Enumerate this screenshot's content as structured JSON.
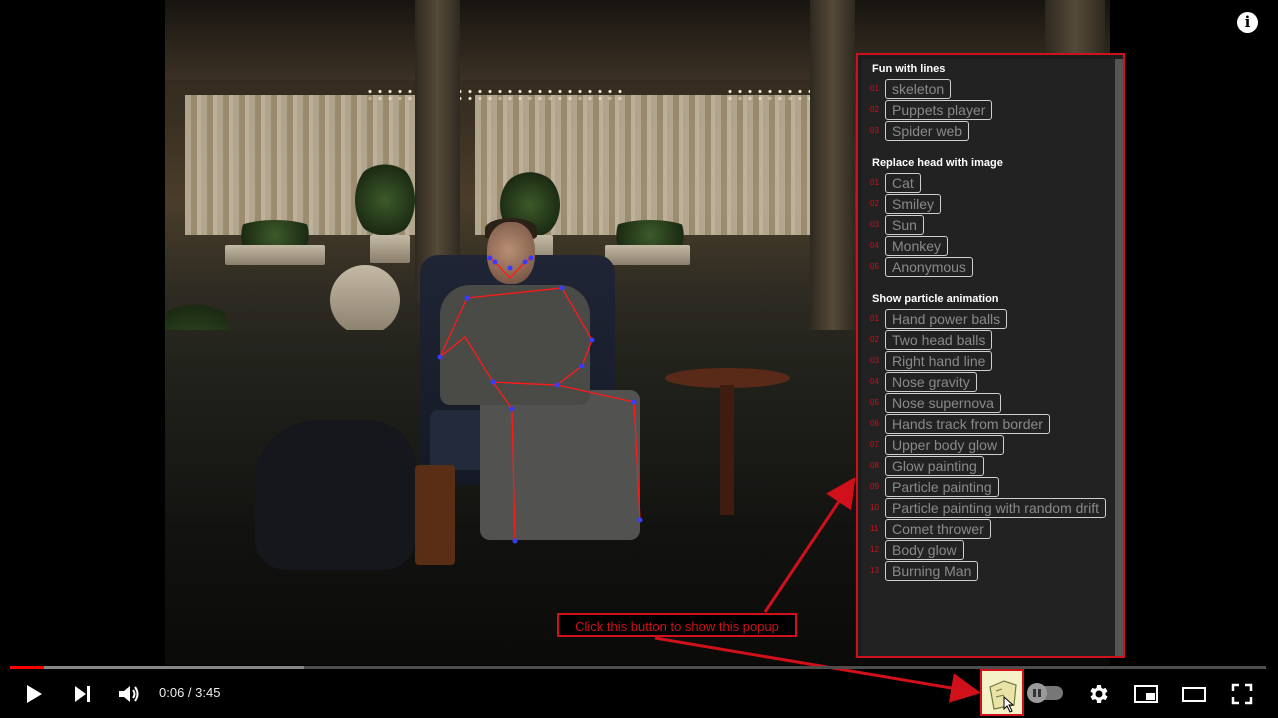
{
  "popup": {
    "sections": [
      {
        "title": "Fun with lines",
        "items": [
          {
            "num": "01",
            "label": "skeleton"
          },
          {
            "num": "02",
            "label": "Puppets player"
          },
          {
            "num": "03",
            "label": "Spider web"
          }
        ]
      },
      {
        "title": "Replace head with image",
        "items": [
          {
            "num": "01",
            "label": "Cat"
          },
          {
            "num": "02",
            "label": "Smiley"
          },
          {
            "num": "03",
            "label": "Sun"
          },
          {
            "num": "04",
            "label": "Monkey"
          },
          {
            "num": "05",
            "label": "Anonymous"
          }
        ]
      },
      {
        "title": "Show particle animation",
        "items": [
          {
            "num": "01",
            "label": "Hand power balls"
          },
          {
            "num": "02",
            "label": "Two head balls"
          },
          {
            "num": "03",
            "label": "Right hand line"
          },
          {
            "num": "04",
            "label": "Nose gravity"
          },
          {
            "num": "05",
            "label": "Nose supernova"
          },
          {
            "num": "06",
            "label": "Hands track from border"
          },
          {
            "num": "07",
            "label": "Upper body glow"
          },
          {
            "num": "08",
            "label": "Glow painting"
          },
          {
            "num": "09",
            "label": "Particle painting"
          },
          {
            "num": "10",
            "label": "Particle painting with random drift"
          },
          {
            "num": "11",
            "label": "Comet thrower"
          },
          {
            "num": "12",
            "label": "Body glow"
          },
          {
            "num": "13",
            "label": "Burning Man"
          }
        ]
      }
    ]
  },
  "annotation": {
    "text": "Click this button to show this popup"
  },
  "player": {
    "time": "0:06 / 3:45",
    "progress_played_fraction": 0.027,
    "progress_buffered_fraction": 0.234,
    "info_label": "i"
  },
  "icons": {
    "play": "play-icon",
    "next": "next-icon",
    "volume": "volume-icon",
    "settings": "gear-icon",
    "miniplayer": "miniplayer-icon",
    "theater": "theater-icon",
    "fullscreen": "fullscreen-icon",
    "autoplay": "autoplay-toggle",
    "extension": "hand-cursor-icon"
  },
  "colors": {
    "accent": "#d0101a",
    "progress": "#ff0000"
  }
}
